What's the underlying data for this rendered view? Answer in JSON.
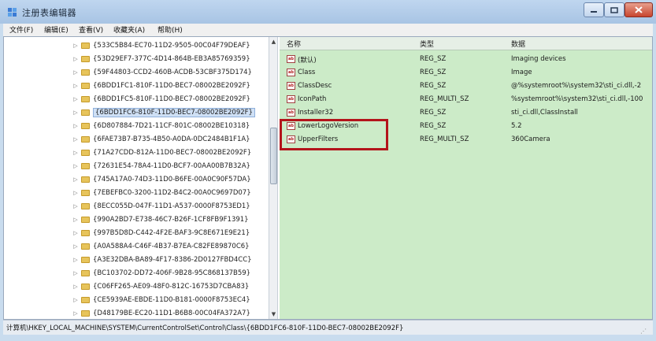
{
  "window": {
    "title": "注册表编辑器"
  },
  "menu": [
    "文件(F)",
    "编辑(E)",
    "查看(V)",
    "收藏夹(A)",
    "帮助(H)"
  ],
  "tree": {
    "items": [
      "{533C5B84-EC70-11D2-9505-00C04F79DEAF}",
      "{53D29EF7-377C-4D14-864B-EB3A85769359}",
      "{59F44803-CCD2-460B-ACDB-53CBF375D174}",
      "{6BDD1FC1-810F-11D0-BEC7-08002BE2092F}",
      "{6BDD1FC5-810F-11D0-BEC7-08002BE2092F}",
      "{6BDD1FC6-810F-11D0-BEC7-08002BE2092F}",
      "{6D807884-7D21-11CF-801C-08002BE10318}",
      "{6FAE73B7-B735-4B50-A0DA-0DC2484B1F1A}",
      "{71A27CDD-812A-11D0-BEC7-08002BE2092F}",
      "{72631E54-78A4-11D0-BCF7-00AA00B7B32A}",
      "{745A17A0-74D3-11D0-B6FE-00A0C90F57DA}",
      "{7EBEFBC0-3200-11D2-B4C2-00A0C9697D07}",
      "{8ECC055D-047F-11D1-A537-0000F8753ED1}",
      "{990A2BD7-E738-46C7-B26F-1CF8FB9F1391}",
      "{997B5D8D-C442-4F2E-BAF3-9C8E671E9E21}",
      "{A0A588A4-C46F-4B37-B7EA-C82FE89870C6}",
      "{A3E32DBA-BA89-4F17-8386-2D0127FBD4CC}",
      "{BC103702-DD72-406F-9B28-95C868137B59}",
      "{C06FF265-AE09-48F0-812C-16753D7CBA83}",
      "{CE5939AE-EBDE-11D0-B181-0000F8753EC4}",
      "{D48179BE-EC20-11D1-B6B8-00C04FA372A7}"
    ],
    "selected_index": 5
  },
  "values": {
    "headers": {
      "name": "名称",
      "type": "类型",
      "data": "数据"
    },
    "rows": [
      {
        "name": "(默认)",
        "type": "REG_SZ",
        "data": "Imaging devices"
      },
      {
        "name": "Class",
        "type": "REG_SZ",
        "data": "Image"
      },
      {
        "name": "ClassDesc",
        "type": "REG_SZ",
        "data": "@%systemroot%\\system32\\sti_ci.dll,-2"
      },
      {
        "name": "IconPath",
        "type": "REG_MULTI_SZ",
        "data": "%systemroot%\\system32\\sti_ci.dll,-100"
      },
      {
        "name": "Installer32",
        "type": "REG_SZ",
        "data": "sti_ci.dll,ClassInstall"
      },
      {
        "name": "LowerLogoVersion",
        "type": "REG_SZ",
        "data": "5.2"
      },
      {
        "name": "UpperFilters",
        "type": "REG_MULTI_SZ",
        "data": "360Camera"
      }
    ],
    "icon_label": "ab"
  },
  "status": {
    "path": "计算机\\HKEY_LOCAL_MACHINE\\SYSTEM\\CurrentControlSet\\Control\\Class\\{6BDD1FC6-810F-11D0-BEC7-08002BE2092F}"
  },
  "colors": {
    "list_background": "#ccebc8",
    "highlight": "#b3141b",
    "selection": "#cfe0f5"
  }
}
